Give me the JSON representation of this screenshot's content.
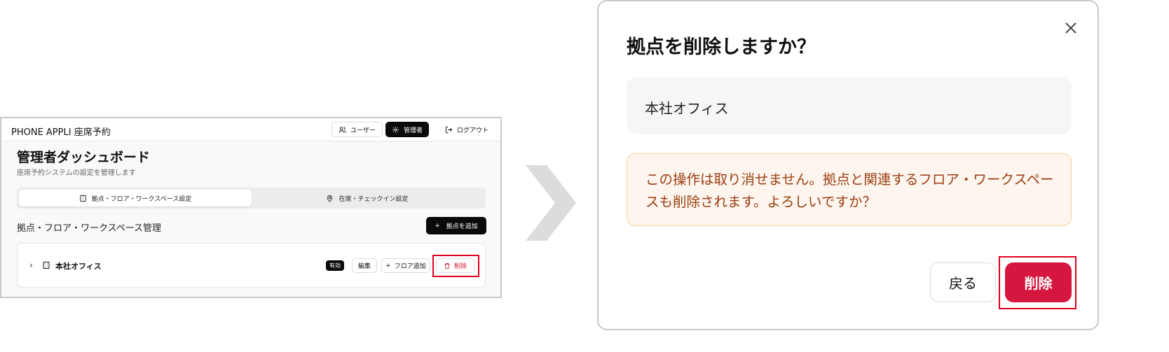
{
  "left_screen": {
    "app_title": "PHONE APPLI 座席予約",
    "header": {
      "user_label": "ユーザー",
      "admin_label": "管理者",
      "logout_label": "ログアウト"
    },
    "page_title": "管理者ダッシュボード",
    "page_subtitle": "座席予約システムの設定を管理します",
    "tabs": [
      {
        "label": "拠点・フロア・ワークスペース設定",
        "active": true
      },
      {
        "label": "在席・チェックイン設定",
        "active": false
      }
    ],
    "section_title": "拠点・フロア・ワークスペース管理",
    "add_site_label": "拠点を追加",
    "site": {
      "name": "本社オフィス",
      "status_badge": "有効",
      "edit_label": "編集",
      "add_floor_label": "フロア追加",
      "delete_label": "削除"
    }
  },
  "dialog": {
    "title": "拠点を削除しますか？",
    "site_name": "本社オフィス",
    "warning": "この操作は取り消せません。拠点と関連するフロア・ワークスペースも削除されます。よろしいですか？",
    "back_label": "戻る",
    "delete_label": "削除"
  },
  "colors": {
    "highlight": "#e1001e",
    "danger": "#d5163f",
    "warning_text": "#9a3d12",
    "warning_bg": "#fef6ee",
    "primary_dark": "#0a0a0a"
  }
}
